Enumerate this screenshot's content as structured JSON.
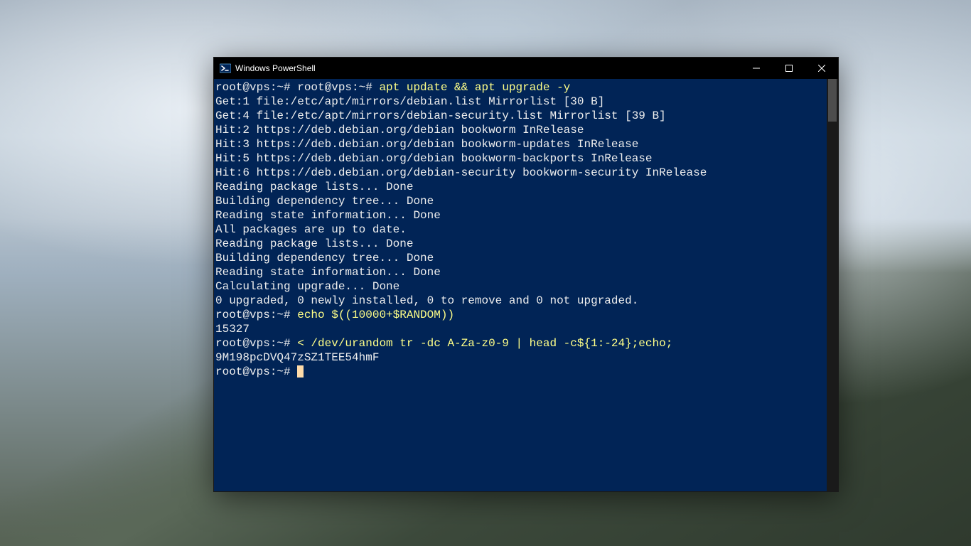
{
  "window": {
    "title": "Windows PowerShell"
  },
  "terminal": {
    "lines": [
      {
        "type": "cmd",
        "prompt": "root@vps:~# root@vps:~# ",
        "command": "apt update && apt upgrade -y"
      },
      {
        "type": "out",
        "text": "Get:1 file:/etc/apt/mirrors/debian.list Mirrorlist [30 B]"
      },
      {
        "type": "out",
        "text": "Get:4 file:/etc/apt/mirrors/debian-security.list Mirrorlist [39 B]"
      },
      {
        "type": "out",
        "text": "Hit:2 https://deb.debian.org/debian bookworm InRelease"
      },
      {
        "type": "out",
        "text": "Hit:3 https://deb.debian.org/debian bookworm-updates InRelease"
      },
      {
        "type": "out",
        "text": "Hit:5 https://deb.debian.org/debian bookworm-backports InRelease"
      },
      {
        "type": "out",
        "text": "Hit:6 https://deb.debian.org/debian-security bookworm-security InRelease"
      },
      {
        "type": "out",
        "text": "Reading package lists... Done"
      },
      {
        "type": "out",
        "text": "Building dependency tree... Done"
      },
      {
        "type": "out",
        "text": "Reading state information... Done"
      },
      {
        "type": "out",
        "text": "All packages are up to date."
      },
      {
        "type": "out",
        "text": "Reading package lists... Done"
      },
      {
        "type": "out",
        "text": "Building dependency tree... Done"
      },
      {
        "type": "out",
        "text": "Reading state information... Done"
      },
      {
        "type": "out",
        "text": "Calculating upgrade... Done"
      },
      {
        "type": "out",
        "text": "0 upgraded, 0 newly installed, 0 to remove and 0 not upgraded."
      },
      {
        "type": "cmd",
        "prompt": "root@vps:~# ",
        "command": "echo $((10000+$RANDOM))"
      },
      {
        "type": "out",
        "text": "15327"
      },
      {
        "type": "cmd",
        "prompt": "root@vps:~# ",
        "command": "< /dev/urandom tr -dc A-Za-z0-9 | head -c${1:-24};echo;"
      },
      {
        "type": "out",
        "text": "9M198pcDVQ47zSZ1TEE54hmF"
      },
      {
        "type": "cmd",
        "prompt": "root@vps:~# ",
        "command": "",
        "cursor": true
      }
    ]
  }
}
